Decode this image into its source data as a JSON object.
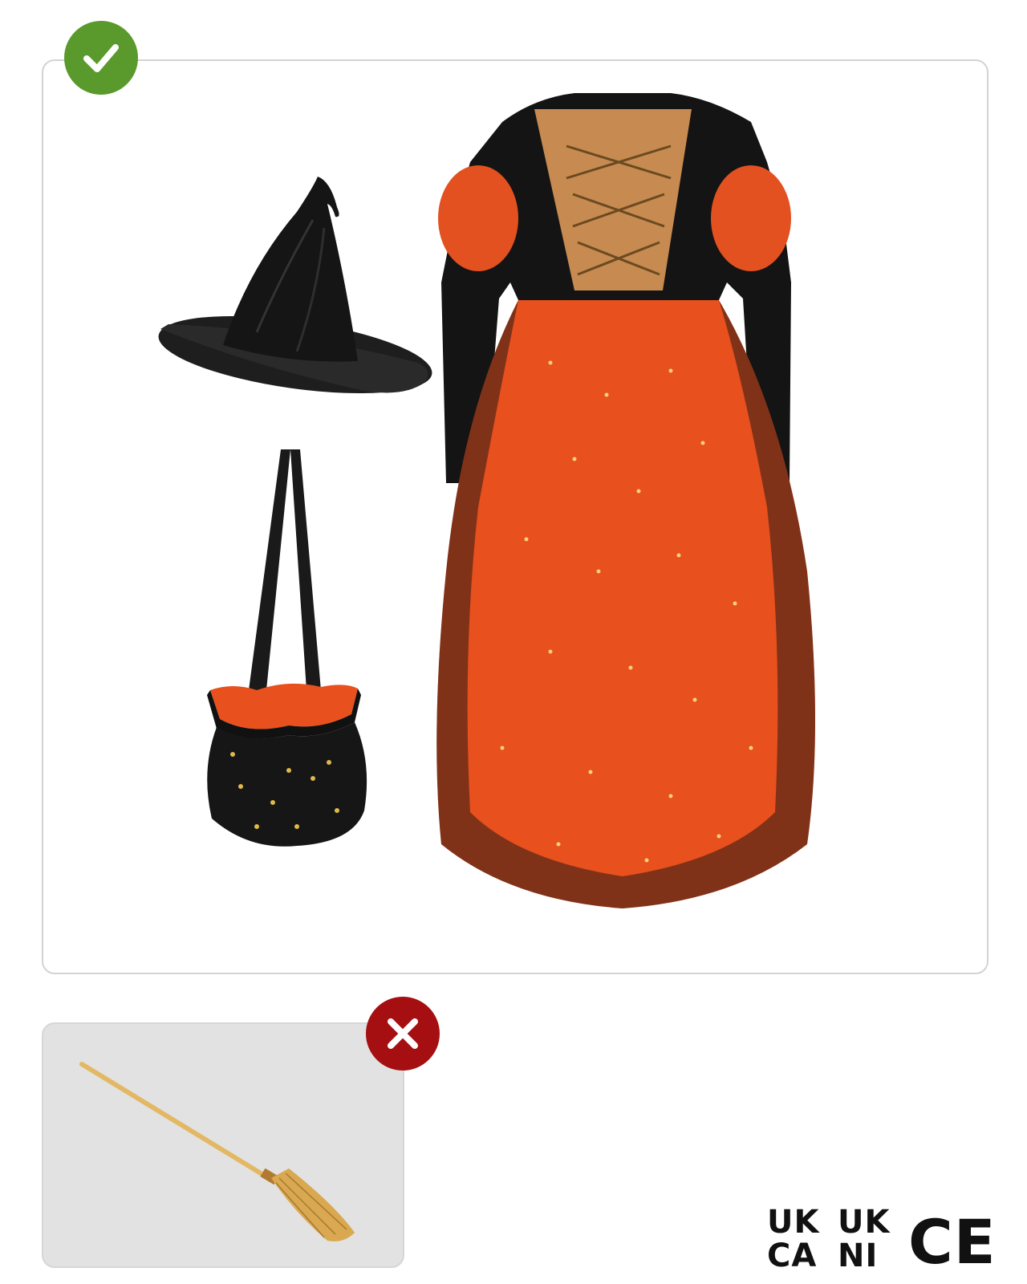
{
  "badges": {
    "included": "check-icon",
    "excluded": "close-icon"
  },
  "colors": {
    "included_badge": "#5a9a2c",
    "excluded_badge": "#a50f12",
    "dress_orange": "#e8501e",
    "velvet_black": "#141414",
    "bodice_gold": "#c78a50",
    "broom_straw": "#d9a850"
  },
  "included_items": [
    {
      "icon": "witch-hat-icon"
    },
    {
      "icon": "drawstring-bag-icon"
    },
    {
      "icon": "witch-dress-icon"
    }
  ],
  "excluded_items": [
    {
      "icon": "broom-icon"
    }
  ],
  "certification": {
    "ukca": [
      "UK",
      "CA"
    ],
    "ukni": [
      "UK",
      "NI"
    ],
    "ce": "CE"
  }
}
